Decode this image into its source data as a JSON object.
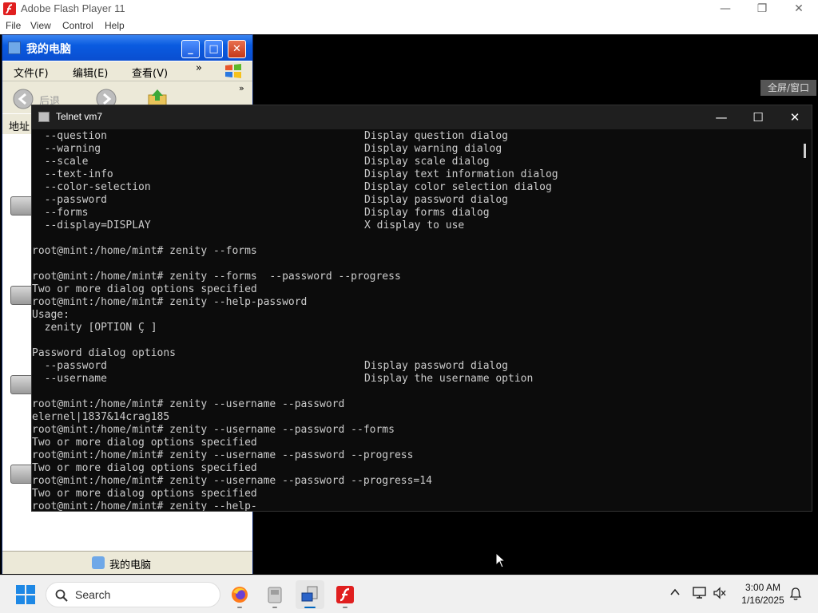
{
  "flash_player": {
    "title": "Adobe Flash Player 11",
    "menu": [
      "File",
      "View",
      "Control",
      "Help"
    ],
    "fullscreen_hint": "全屏/窗口"
  },
  "my_computer": {
    "title": "我的电脑",
    "menu": [
      "文件(F)",
      "编辑(E)",
      "查看(V)"
    ],
    "menu_more": "»",
    "toolbar_back": "后退",
    "address_label": "地址",
    "status_text": "我的电脑"
  },
  "telnet": {
    "title": "Telnet vm7",
    "lines": [
      {
        "text": "  --question",
        "desc": "Display question dialog"
      },
      {
        "text": "  --warning",
        "desc": "Display warning dialog"
      },
      {
        "text": "  --scale",
        "desc": "Display scale dialog"
      },
      {
        "text": "  --text-info",
        "desc": "Display text information dialog"
      },
      {
        "text": "  --color-selection",
        "desc": "Display color selection dialog"
      },
      {
        "text": "  --password",
        "desc": "Display password dialog"
      },
      {
        "text": "  --forms",
        "desc": "Display forms dialog"
      },
      {
        "text": "  --display=DISPLAY",
        "desc": "X display to use"
      },
      {
        "text": "",
        "desc": ""
      },
      {
        "text": "root@mint:/home/mint# zenity --forms",
        "desc": ""
      },
      {
        "text": "",
        "desc": ""
      },
      {
        "text": "root@mint:/home/mint# zenity --forms  --password --progress",
        "desc": ""
      },
      {
        "text": "Two or more dialog options specified",
        "desc": ""
      },
      {
        "text": "root@mint:/home/mint# zenity --help-password",
        "desc": ""
      },
      {
        "text": "Usage:",
        "desc": ""
      },
      {
        "text": "  zenity [OPTION Ç ]",
        "desc": ""
      },
      {
        "text": "",
        "desc": ""
      },
      {
        "text": "Password dialog options",
        "desc": ""
      },
      {
        "text": "  --password",
        "desc": "Display password dialog"
      },
      {
        "text": "  --username",
        "desc": "Display the username option"
      },
      {
        "text": "",
        "desc": ""
      },
      {
        "text": "root@mint:/home/mint# zenity --username --password",
        "desc": ""
      },
      {
        "text": "elernel|1837&14crag185",
        "desc": ""
      },
      {
        "text": "root@mint:/home/mint# zenity --username --password --forms",
        "desc": ""
      },
      {
        "text": "Two or more dialog options specified",
        "desc": ""
      },
      {
        "text": "root@mint:/home/mint# zenity --username --password --progress",
        "desc": ""
      },
      {
        "text": "Two or more dialog options specified",
        "desc": ""
      },
      {
        "text": "root@mint:/home/mint# zenity --username --password --progress=14",
        "desc": ""
      },
      {
        "text": "Two or more dialog options specified",
        "desc": ""
      },
      {
        "text": "root@mint:/home/mint# zenity --help-",
        "desc": ""
      }
    ]
  },
  "taskbar": {
    "search_placeholder": "Search",
    "apps": [
      "firefox-icon",
      "file-manager-icon",
      "telnet-icon",
      "flash-player-icon"
    ],
    "time": "3:00 AM",
    "date": "1/16/2025"
  },
  "colors": {
    "terminal_bg": "#0c0c0c",
    "terminal_fg": "#cccccc",
    "xp_titlebar": "#0a5be0",
    "accent": "#0067c0"
  }
}
